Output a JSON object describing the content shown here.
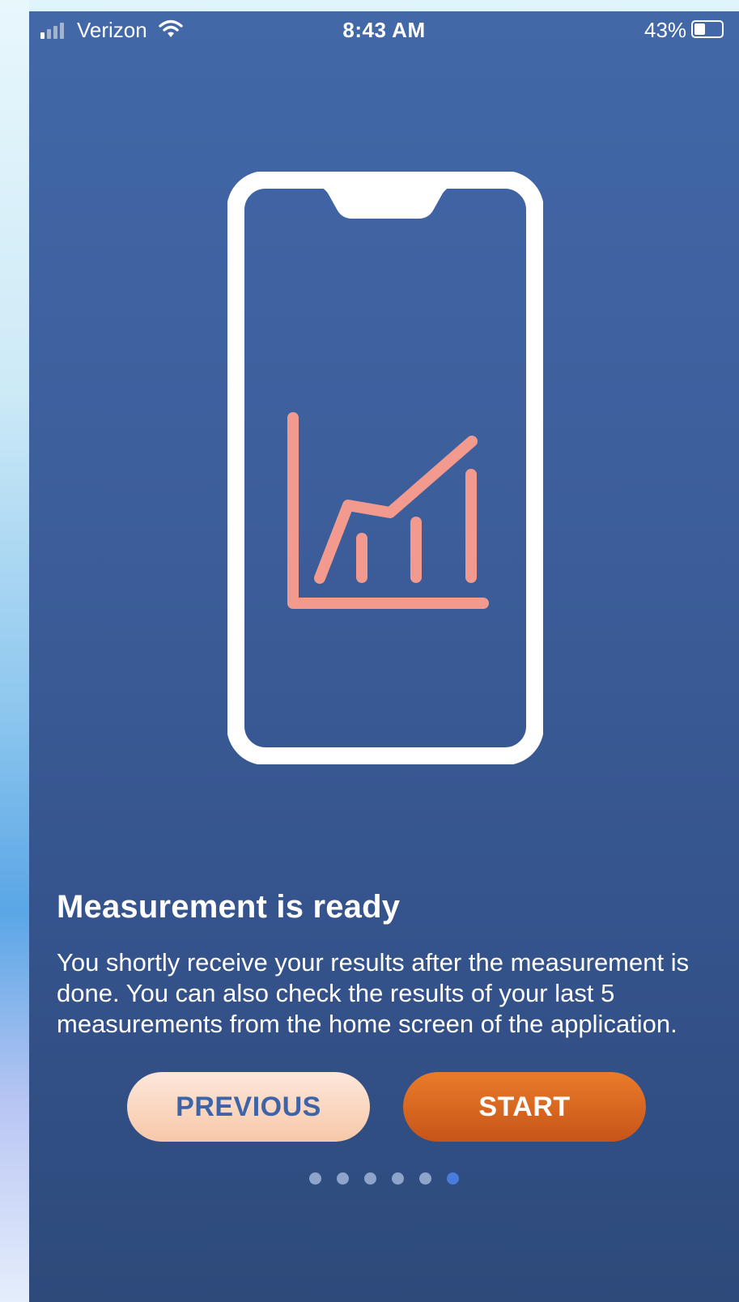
{
  "status_bar": {
    "carrier": "Verizon",
    "time": "8:43 AM",
    "battery_percent": "43%",
    "battery_level": 0.43,
    "icons": [
      "signal-icon",
      "wifi-icon",
      "battery-icon"
    ]
  },
  "illustration": {
    "icon": "phone-with-chart-icon",
    "chart_color": "#f29a8d",
    "phone_color": "#ffffff"
  },
  "onboarding": {
    "title": "Measurement is ready",
    "description": "You shortly receive your results after the measurement is done. You can also check the results of your last 5 measurements from the home screen of the application.",
    "previous_label": "PREVIOUS",
    "start_label": "START",
    "page_count": 6,
    "current_page": 6
  },
  "colors": {
    "background": "#3d5f9c",
    "start_button": "#e06a22",
    "previous_button": "#fcd9c4",
    "previous_text": "#3e64a8",
    "active_dot": "#4a7ddb",
    "inactive_dot": "#8ea5cb"
  }
}
